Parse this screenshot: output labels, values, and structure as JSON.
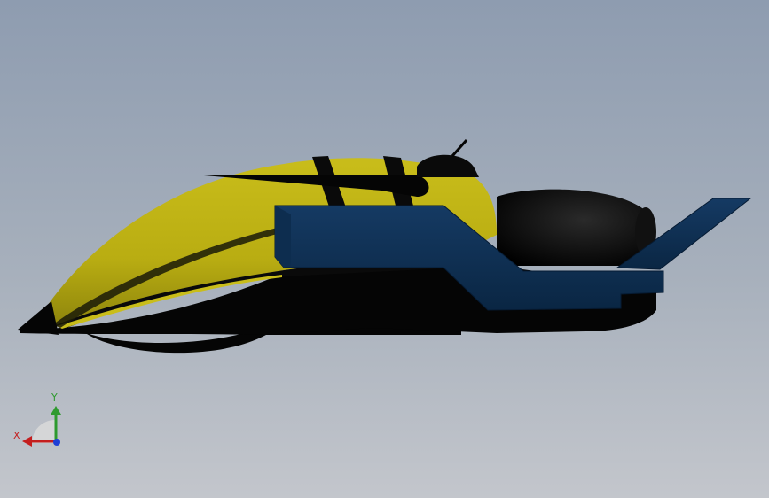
{
  "triad": {
    "x_label": "X",
    "y_label": "Y"
  },
  "colors": {
    "background_top": "#8e9cb0",
    "background_bottom": "#c3c6cc",
    "hull_yellow": "#c9bd1a",
    "frame_blue": "#0f2f52",
    "body_black": "#050505",
    "axis_x": "#c41e1e",
    "axis_y": "#2e9a2e",
    "axis_z": "#1f3fd6"
  }
}
